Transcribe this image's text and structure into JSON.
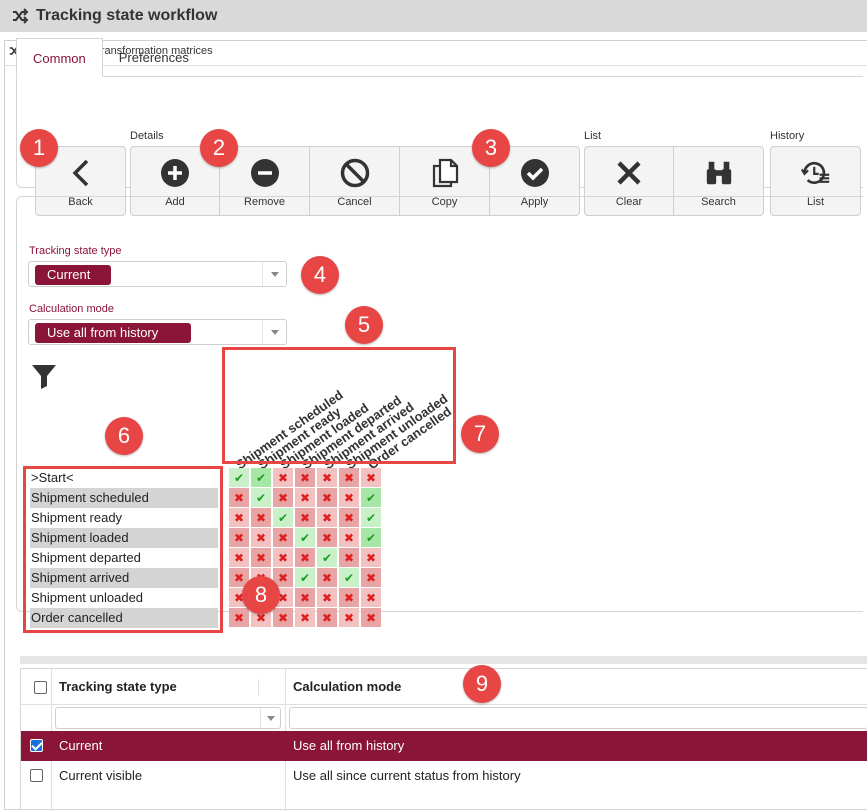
{
  "window": {
    "title": "Tracking state workflow"
  },
  "panel": {
    "title": "Tracking state transformation matrices"
  },
  "tabs": [
    {
      "label": "Common",
      "active": true
    },
    {
      "label": "Preferences",
      "active": false
    }
  ],
  "toolbar": {
    "groups": {
      "details": "Details",
      "list": "List",
      "history": "History"
    },
    "back": "Back",
    "add": "Add",
    "remove": "Remove",
    "cancel": "Cancel",
    "copy": "Copy",
    "apply": "Apply",
    "clear": "Clear",
    "search": "Search",
    "history_list": "List"
  },
  "form": {
    "tracking_state_type_label": "Tracking state type",
    "tracking_state_type_value": "Current",
    "calculation_mode_label": "Calculation mode",
    "calculation_mode_value": "Use all from history"
  },
  "matrix": {
    "columns": [
      "Shipment scheduled",
      "Shipment ready",
      "Shipment loaded",
      "Shipment departed",
      "Shipment arrived",
      "Shipment unloaded",
      "Order cancelled"
    ],
    "rows": [
      ">Start<",
      "Shipment scheduled",
      "Shipment ready",
      "Shipment loaded",
      "Shipment departed",
      "Shipment arrived",
      "Shipment unloaded",
      "Order cancelled"
    ],
    "cells": [
      [
        1,
        1,
        0,
        0,
        0,
        0,
        0
      ],
      [
        0,
        1,
        0,
        0,
        0,
        0,
        1
      ],
      [
        0,
        0,
        1,
        0,
        0,
        0,
        1
      ],
      [
        0,
        0,
        0,
        1,
        0,
        0,
        1
      ],
      [
        0,
        0,
        0,
        0,
        1,
        0,
        0
      ],
      [
        0,
        0,
        0,
        1,
        0,
        1,
        0
      ],
      [
        0,
        0,
        0,
        0,
        0,
        0,
        0
      ],
      [
        0,
        0,
        0,
        0,
        0,
        0,
        0
      ]
    ]
  },
  "annotations": [
    "1",
    "2",
    "3",
    "4",
    "5",
    "6",
    "7",
    "8",
    "9"
  ],
  "grid": {
    "columns": [
      "Tracking state type",
      "Calculation mode"
    ],
    "rows": [
      {
        "type": "Current",
        "mode": "Use all from history",
        "selected": true
      },
      {
        "type": "Current visible",
        "mode": "Use all since current status from history",
        "selected": false
      }
    ]
  },
  "colors": {
    "accent": "#8a1538",
    "badge": "#e84545",
    "ok": "#1f9b1f",
    "no": "#e02020"
  }
}
